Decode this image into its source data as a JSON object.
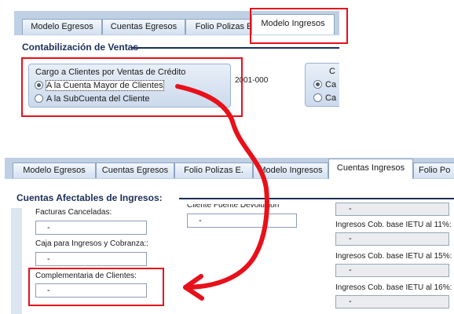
{
  "top": {
    "tabs": [
      {
        "label": "Modelo Egresos"
      },
      {
        "label": "Cuentas Egresos"
      },
      {
        "label": "Folio Polizas E."
      },
      {
        "label": "Modelo Ingresos"
      }
    ],
    "section_title": "Contabilización de Ventas",
    "group": {
      "title": "Cargo a Clientes por Ventas de Crédito",
      "options": [
        {
          "label": "A la Cuenta Mayor de Clientes",
          "selected": true
        },
        {
          "label": "A la SubCuenta del Cliente",
          "selected": false
        }
      ]
    },
    "account_code": "2001-000",
    "partial_group": {
      "title": "C",
      "options": [
        {
          "label": "Ca",
          "selected": true
        },
        {
          "label": "Ca",
          "selected": false
        }
      ]
    }
  },
  "bottom": {
    "tabs": [
      {
        "label": "Modelo Egresos"
      },
      {
        "label": "Cuentas Egresos"
      },
      {
        "label": "Folio Polizas E."
      },
      {
        "label": "Modelo Ingresos"
      },
      {
        "label": "Cuentas Ingresos"
      },
      {
        "label": "Folio Po"
      }
    ],
    "section_title": "Cuentas Afectables de Ingresos:",
    "left_fields": [
      {
        "label": "Facturas Canceladas:",
        "value": "-"
      },
      {
        "label": "Caja para Ingresos y Cobranza::",
        "value": "-"
      },
      {
        "label": "Complementaria de Clientes:",
        "value": "-"
      }
    ],
    "middle_field": {
      "label": "Cliente Fuente Devolución",
      "value": "-"
    },
    "right_fields": [
      {
        "label": "",
        "value": "-"
      },
      {
        "label": "Ingresos Cob. base IETU al 11%:",
        "value": "-"
      },
      {
        "label": "Ingresos Cob. base IETU al 15%:",
        "value": "-"
      },
      {
        "label": "Ingresos Cob. base IETU al 16%:",
        "value": "-"
      }
    ]
  },
  "annotations": {
    "highlight_color": "#e8101a"
  }
}
